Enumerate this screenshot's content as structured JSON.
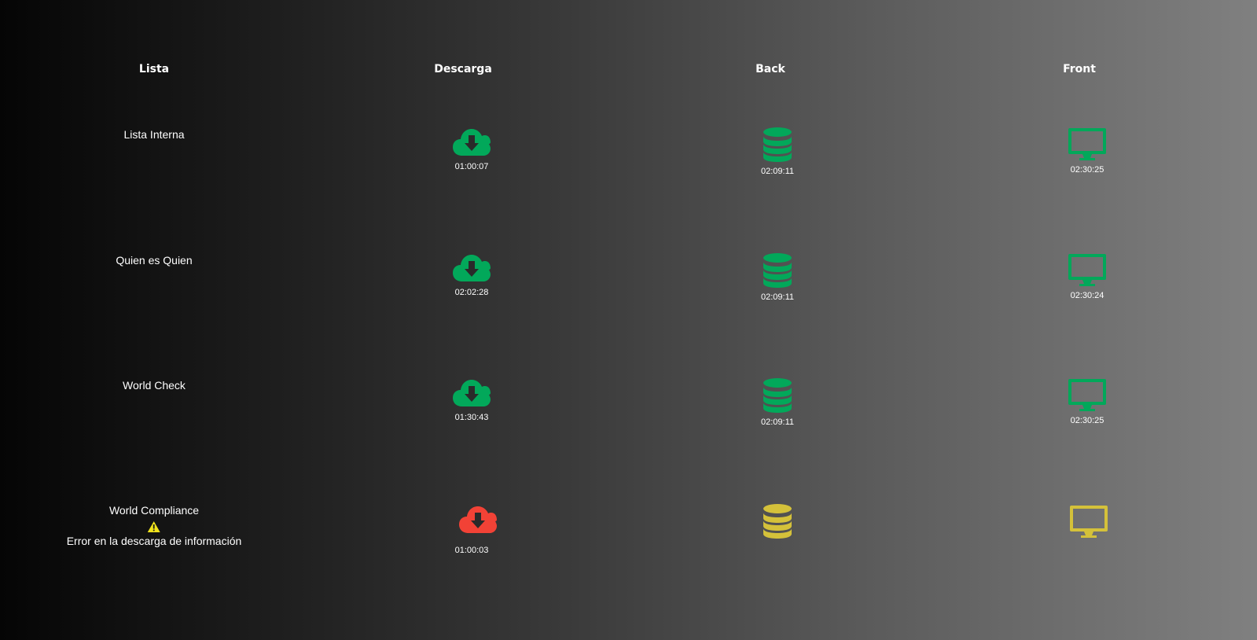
{
  "headers": {
    "lista": "Lista",
    "descarga": "Descarga",
    "back": "Back",
    "front": "Front"
  },
  "colors": {
    "ok": "#02a85a",
    "error": "#f24236",
    "pending": "#d4c13a",
    "warning": "#f0e21c"
  },
  "rows": [
    {
      "name": "Lista Interna",
      "descarga": {
        "icon": "cloud-download-icon",
        "status": "ok",
        "time": "01:00:07"
      },
      "back": {
        "icon": "database-icon",
        "status": "ok",
        "time": "02:09:11"
      },
      "front": {
        "icon": "monitor-icon",
        "status": "ok",
        "time": "02:30:25"
      }
    },
    {
      "name": "Quien es Quien",
      "descarga": {
        "icon": "cloud-download-icon",
        "status": "ok",
        "time": "02:02:28"
      },
      "back": {
        "icon": "database-icon",
        "status": "ok",
        "time": "02:09:11"
      },
      "front": {
        "icon": "monitor-icon",
        "status": "ok",
        "time": "02:30:24"
      }
    },
    {
      "name": "World Check",
      "descarga": {
        "icon": "cloud-download-icon",
        "status": "ok",
        "time": "01:30:43"
      },
      "back": {
        "icon": "database-icon",
        "status": "ok",
        "time": "02:09:11"
      },
      "front": {
        "icon": "monitor-icon",
        "status": "ok",
        "time": "02:30:25"
      }
    },
    {
      "name": "World Compliance",
      "warning_icon": "warning-triangle-icon",
      "error_message": "Error en la descarga de información",
      "descarga": {
        "icon": "cloud-download-icon",
        "status": "error",
        "time": "01:00:03"
      },
      "back": {
        "icon": "database-icon",
        "status": "pending",
        "time": ""
      },
      "front": {
        "icon": "monitor-icon",
        "status": "pending",
        "time": ""
      }
    }
  ]
}
